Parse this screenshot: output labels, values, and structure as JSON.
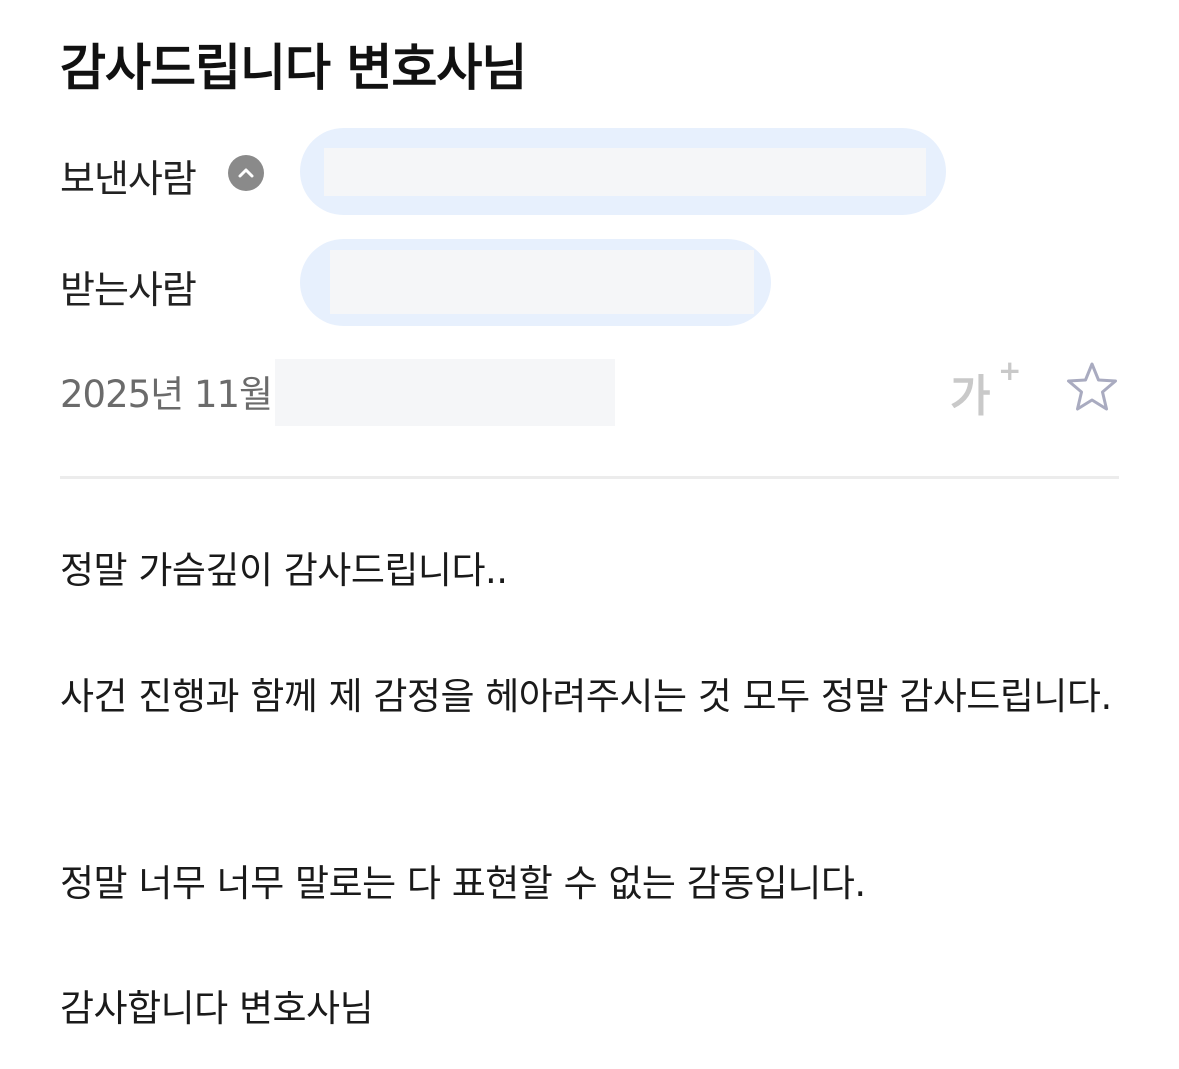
{
  "email": {
    "subject": "감사드립니다 변호사님",
    "sender_label": "보낸사람",
    "recipient_label": "받는사람",
    "date_prefix": "2025년 11월",
    "font_size_button": {
      "main": "가",
      "plus": "+"
    },
    "body": [
      "정말 가슴깊이 감사드립니다..",
      "사건 진행과 함께 제 감정을 헤아려주시는 것 모두 정말 감사드립니다.",
      "정말 너무 너무 말로는 다 표현할 수 없는 감동입니다.",
      "감사합니다 변호사님"
    ]
  },
  "icons": {
    "toggle": "chevron-up-icon",
    "font_size": "font-size-increase-icon",
    "star": "star-outline-icon"
  },
  "colors": {
    "chip_background": "#e7f0fd",
    "redaction": "#f5f6f8",
    "toggle_circle": "#8a8a8a",
    "muted_icon": "#c9c9c9",
    "star_stroke": "#a9abc0",
    "divider": "#ececec",
    "date_text": "#6b6b6b"
  }
}
